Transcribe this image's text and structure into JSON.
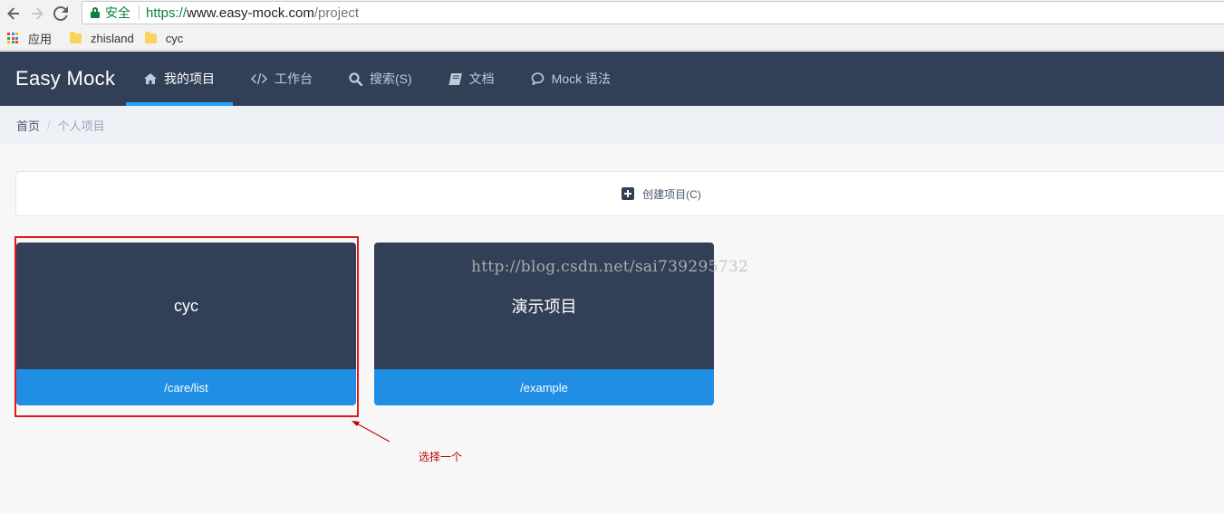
{
  "browser": {
    "secure_label": "安全",
    "url_scheme": "https://",
    "url_host": "www.easy-mock.com",
    "url_path": "/project",
    "bookmarks": [
      {
        "label": "应用"
      },
      {
        "label": "zhisland"
      },
      {
        "label": "cyc"
      }
    ]
  },
  "header": {
    "brand": "Easy Mock",
    "menu": [
      {
        "label": "我的项目",
        "icon": "home-icon",
        "active": true
      },
      {
        "label": "工作台",
        "icon": "code-icon",
        "active": false
      },
      {
        "label": "搜索(S)",
        "icon": "search-icon",
        "active": false
      },
      {
        "label": "文档",
        "icon": "book-icon",
        "active": false
      },
      {
        "label": "Mock 语法",
        "icon": "comment-icon",
        "active": false
      }
    ]
  },
  "breadcrumb": {
    "home": "首页",
    "separator": "/",
    "current": "个人项目"
  },
  "create": {
    "label": "创建项目(C)"
  },
  "projects": [
    {
      "name": "cyc",
      "path": "/care/list"
    },
    {
      "name": "演示项目",
      "path": "/example"
    }
  ],
  "annotations": {
    "watermark": "http://blog.csdn.net/sai739295732",
    "callout": "选择一个"
  },
  "colors": {
    "header_bg": "#324057",
    "accent": "#20a0ff",
    "card_footer": "#1f8ee3",
    "annotation_red": "#e0191a"
  }
}
